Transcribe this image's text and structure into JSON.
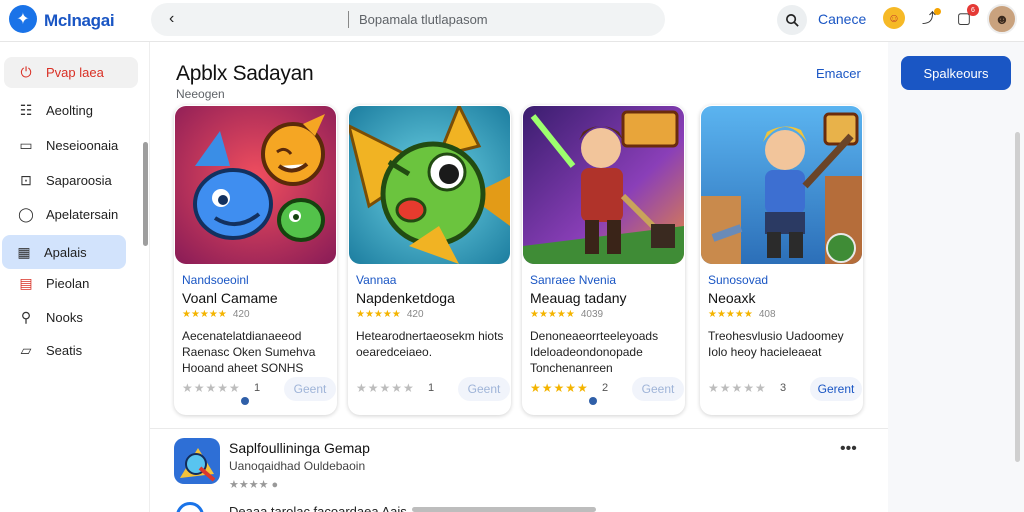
{
  "app": {
    "brand": "Mclnagai",
    "brand_accent": "i"
  },
  "topbar": {
    "search_placeholder": "Bopamala tlutlapasom",
    "cancel_label": "Canece",
    "notif_count": "6"
  },
  "sidebar": {
    "items": [
      {
        "label": "Pvap laea",
        "icon": "power-icon"
      },
      {
        "label": "Aeolting",
        "icon": "list-icon"
      },
      {
        "label": "Neseioonaia",
        "icon": "document-icon"
      },
      {
        "label": "Saparoosia",
        "icon": "window-icon"
      },
      {
        "label": "Apelatersain",
        "icon": "chat-bubble-icon"
      },
      {
        "label": "Apalais",
        "icon": "grid-icon"
      },
      {
        "label": "Pieolan",
        "icon": "book-icon"
      },
      {
        "label": "Nooks",
        "icon": "wrench-icon"
      },
      {
        "label": "Seatis",
        "icon": "folder-icon"
      }
    ]
  },
  "section": {
    "title": "Apblx Sadayan",
    "subtitle": "Neeogen",
    "link": "Emacer"
  },
  "cards": [
    {
      "category": "Nandsoeoinl",
      "name": "Voanl Camame",
      "rating": "★★★★★",
      "rating_num": "420",
      "desc": "Aecenatelatdianaeeod Raenasc Oken Sumehva Hooand aheet SONHS",
      "stars": "★★★★★",
      "count": "1",
      "get": "Geent"
    },
    {
      "category": "Vannaa",
      "name": "Napdenketdoga",
      "rating": "★★★★★",
      "rating_num": "420",
      "desc": "Hetearodnertaeosekm hiots oearedceiaeo.",
      "stars": "★★★★★",
      "count": "1",
      "get": "Geent"
    },
    {
      "category": "Sanraee Nvenia",
      "name": "Meauag tadany",
      "rating": "★★★★★",
      "rating_num": "4039",
      "desc": "Denoneaeorrteeleyoads Ideloadeondonopade Tonchenanreen",
      "stars": "★★★★★",
      "count": "2",
      "get": "Geent"
    },
    {
      "category": "Sunosovad",
      "name": "Neoaxk",
      "rating": "★★★★★",
      "rating_num": "408",
      "desc": "Treohesvlusio Uadoomey Iolo heoy hacieleaeat",
      "stars": "★★★★★",
      "count": "3",
      "get": "Gerent"
    }
  ],
  "list": {
    "row1_title": "Saplfoullininga Gemap",
    "row1_sub": "Uanoqaidhad Ouldebaoin",
    "row1_meta": "★★★★ ●",
    "row2_title": "Deaaa tarolac facoardaea Aais"
  },
  "right_panel": {
    "cta": "Spalkeours"
  },
  "colors": {
    "accent": "#1a56c4",
    "primary_red": "#d93025",
    "star": "#f4b400"
  }
}
